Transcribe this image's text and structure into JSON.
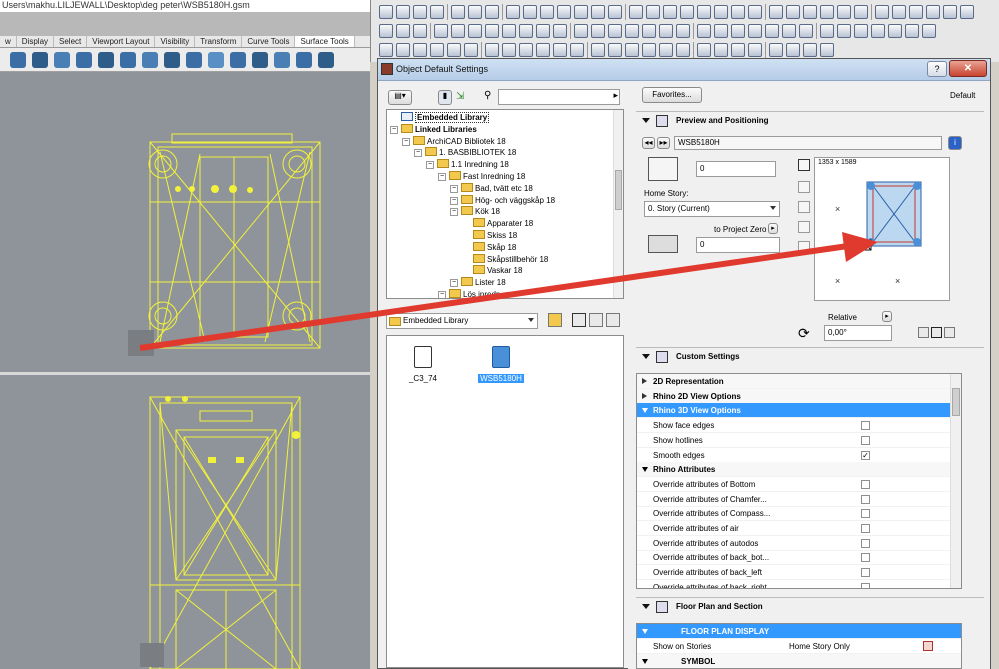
{
  "rhino": {
    "title": "Users\\makhu.LILJEWALL\\Desktop\\deg peter\\WSB5180H.gsm",
    "tabs": [
      "w",
      "Display",
      "Select",
      "Viewport Layout",
      "Visibility",
      "Transform",
      "Curve Tools",
      "Surface Tools"
    ],
    "active_tab": "Surface Tools"
  },
  "dialog": {
    "title": "Object Default Settings",
    "help": "?",
    "close": "✕",
    "favorites_button": "Favorites...",
    "default_label": "Default",
    "tree": [
      {
        "label": "Embedded Library",
        "level": 0,
        "bold": true
      },
      {
        "label": "Linked Libraries",
        "level": 0,
        "bold": true
      },
      {
        "label": "ArchiCAD Bibliotek 18",
        "level": 1
      },
      {
        "label": "1. BASBIBLIOTEK 18",
        "level": 2
      },
      {
        "label": "1.1 Inredning 18",
        "level": 3
      },
      {
        "label": "Fast Inredning 18",
        "level": 4
      },
      {
        "label": "Bad, tvätt etc 18",
        "level": 5
      },
      {
        "label": "Hög- och väggskåp 18",
        "level": 5
      },
      {
        "label": "Kök 18",
        "level": 5
      },
      {
        "label": "Apparater 18",
        "level": 6
      },
      {
        "label": "Skiss 18",
        "level": 6
      },
      {
        "label": "Skåp 18",
        "level": 6
      },
      {
        "label": "Skåpstillbehör 18",
        "level": 6
      },
      {
        "label": "Vaskar 18",
        "level": 6
      },
      {
        "label": "Lister 18",
        "level": 5
      },
      {
        "label": "Lös inredn",
        "level": 4
      }
    ],
    "library_select": "Embedded Library",
    "files": [
      {
        "name": "_C3_74",
        "selected": false
      },
      {
        "name": "WSB5180H",
        "selected": true
      }
    ],
    "preview": {
      "section_title": "Preview and Positioning",
      "object_name": "WSB5180H",
      "elevation_value": "0",
      "home_story_label": "Home Story:",
      "home_story_value": "0. Story (Current)",
      "to_project_zero": "to Project Zero",
      "project_zero_value": "0",
      "size_label": "1353 x 1589",
      "relative_label": "Relative",
      "angle_value": "0,00°"
    },
    "custom_settings": {
      "section_title": "Custom Settings",
      "rows": [
        {
          "type": "group",
          "label": "2D Representation",
          "open": false,
          "active": false
        },
        {
          "type": "group",
          "label": "Rhino 2D View Options",
          "open": false,
          "active": false
        },
        {
          "type": "group",
          "label": "Rhino 3D View Options",
          "open": true,
          "active": true
        },
        {
          "type": "item",
          "label": "Show face edges",
          "checked": false
        },
        {
          "type": "item",
          "label": "Show hotlines",
          "checked": false
        },
        {
          "type": "item",
          "label": "Smooth edges",
          "checked": true
        },
        {
          "type": "group",
          "label": "Rhino Attributes",
          "open": true,
          "active": false
        },
        {
          "type": "item",
          "label": "Override attributes of Bottom",
          "checked": false
        },
        {
          "type": "item",
          "label": "Override attributes of Chamfer...",
          "checked": false
        },
        {
          "type": "item",
          "label": "Override attributes of Compass...",
          "checked": false
        },
        {
          "type": "item",
          "label": "Override attributes of air",
          "checked": false
        },
        {
          "type": "item",
          "label": "Override attributes of autodos",
          "checked": false
        },
        {
          "type": "item",
          "label": "Override attributes of back_bot...",
          "checked": false
        },
        {
          "type": "item",
          "label": "Override attributes of back_left",
          "checked": false
        },
        {
          "type": "item",
          "label": "Override attributes of back_right",
          "checked": false
        }
      ]
    },
    "floor_plan": {
      "section_title": "Floor Plan and Section",
      "group1": "FLOOR PLAN DISPLAY",
      "show_on_stories_label": "Show on Stories",
      "show_on_stories_value": "Home Story Only",
      "group2": "SYMBOL"
    }
  },
  "colors": {
    "wire": "#f2f23a",
    "arrow": "#e03a2e",
    "selection": "#3399ff"
  }
}
